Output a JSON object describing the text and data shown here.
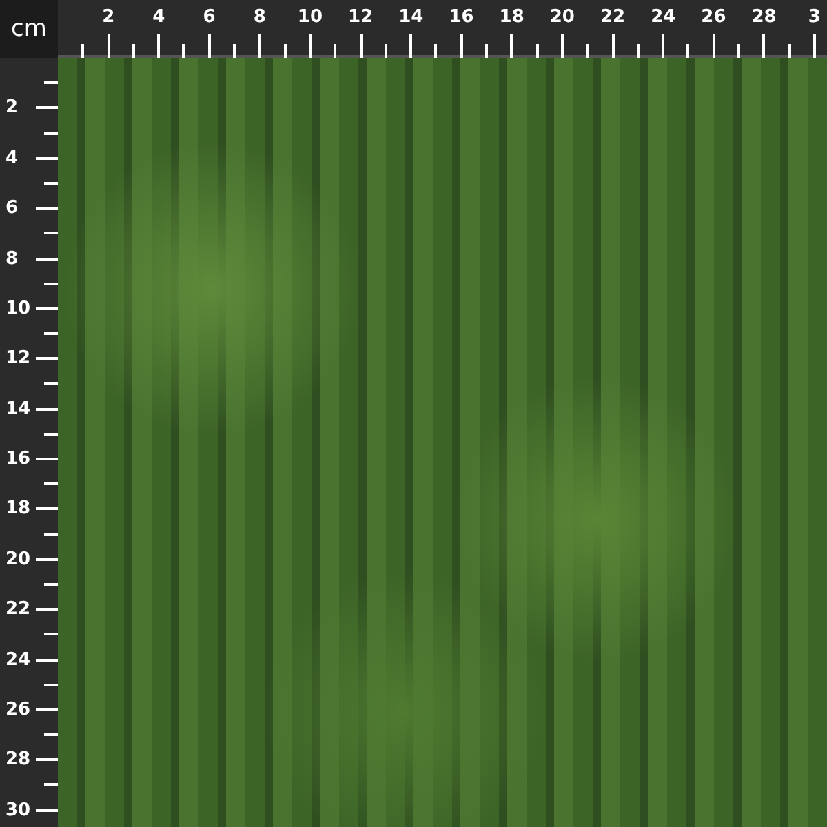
{
  "unit": "cm",
  "top_ruler": {
    "labels": [
      "2",
      "4",
      "6",
      "8",
      "10",
      "12",
      "14",
      "16",
      "18",
      "20",
      "22",
      "24",
      "26",
      "28",
      "3"
    ]
  },
  "left_ruler": {
    "labels": [
      "2",
      "4",
      "6",
      "8",
      "10",
      "12",
      "14",
      "16",
      "18",
      "20",
      "22",
      "24",
      "26",
      "28",
      "30"
    ]
  },
  "photo": {
    "kind": "photo"
  }
}
